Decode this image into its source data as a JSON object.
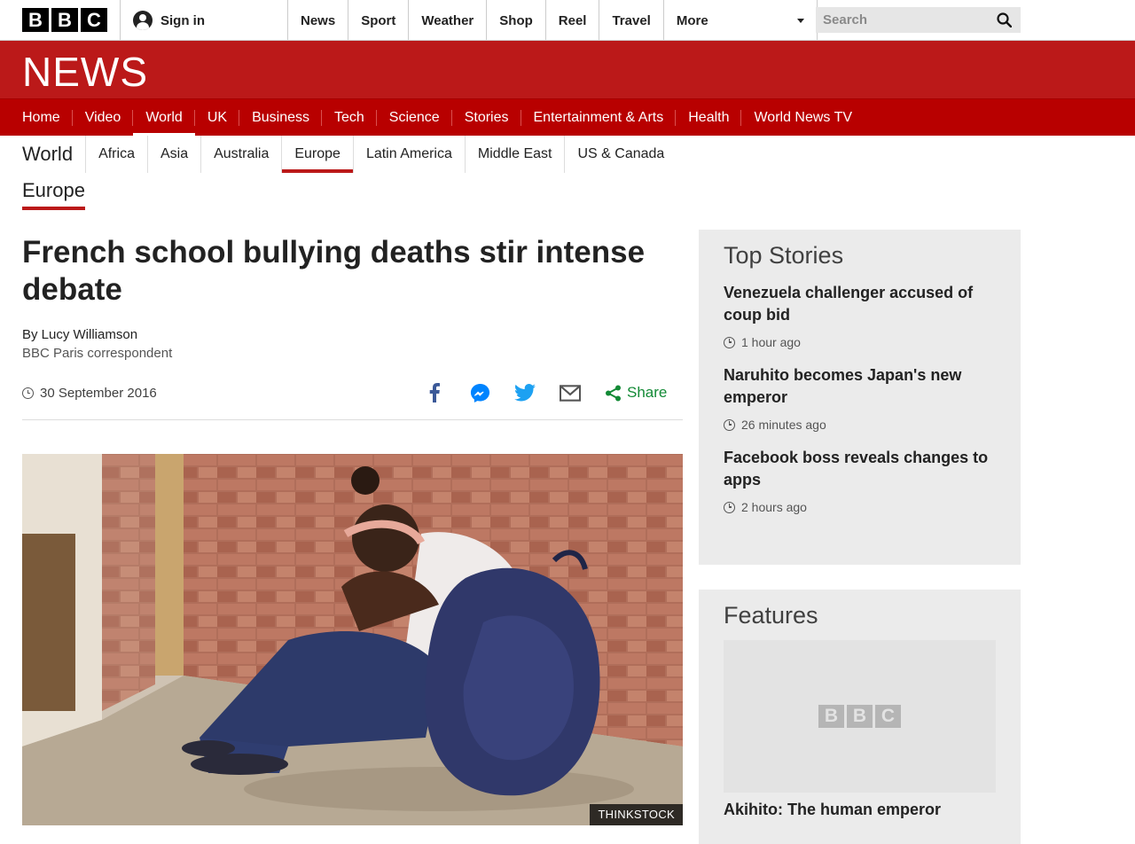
{
  "topbar": {
    "logo_letters": [
      "B",
      "B",
      "C"
    ],
    "signin_label": "Sign in",
    "nav": [
      "News",
      "Sport",
      "Weather",
      "Shop",
      "Reel",
      "Travel"
    ],
    "more_label": "More",
    "search_placeholder": "Search"
  },
  "masthead": {
    "title": "NEWS",
    "nav": [
      "Home",
      "Video",
      "World",
      "UK",
      "Business",
      "Tech",
      "Science",
      "Stories",
      "Entertainment & Arts",
      "Health",
      "World News TV"
    ],
    "active_nav": "World",
    "brand_color": "#bb1919"
  },
  "secondary_nav": {
    "title": "World",
    "items": [
      "Africa",
      "Asia",
      "Australia",
      "Europe",
      "Latin America",
      "Middle East",
      "US & Canada"
    ],
    "active": "Europe"
  },
  "section_label": "Europe",
  "article": {
    "headline": "French school bullying deaths stir intense debate",
    "author": "By Lucy Williamson",
    "author_role": "BBC Paris correspondent",
    "date": "30 September 2016",
    "share_label": "Share",
    "image_credit": "THINKSTOCK",
    "share_icons": [
      "facebook-icon",
      "messenger-icon",
      "twitter-icon",
      "email-icon"
    ]
  },
  "top_stories": {
    "heading": "Top Stories",
    "items": [
      {
        "title": "Venezuela challenger accused of coup bid",
        "time": "1 hour ago"
      },
      {
        "title": "Naruhito becomes Japan's new emperor",
        "time": "26 minutes ago"
      },
      {
        "title": "Facebook boss reveals changes to apps",
        "time": "2 hours ago"
      }
    ]
  },
  "features": {
    "heading": "Features",
    "placeholder_letters": [
      "B",
      "B",
      "C"
    ],
    "item_title": "Akihito: The human emperor"
  }
}
